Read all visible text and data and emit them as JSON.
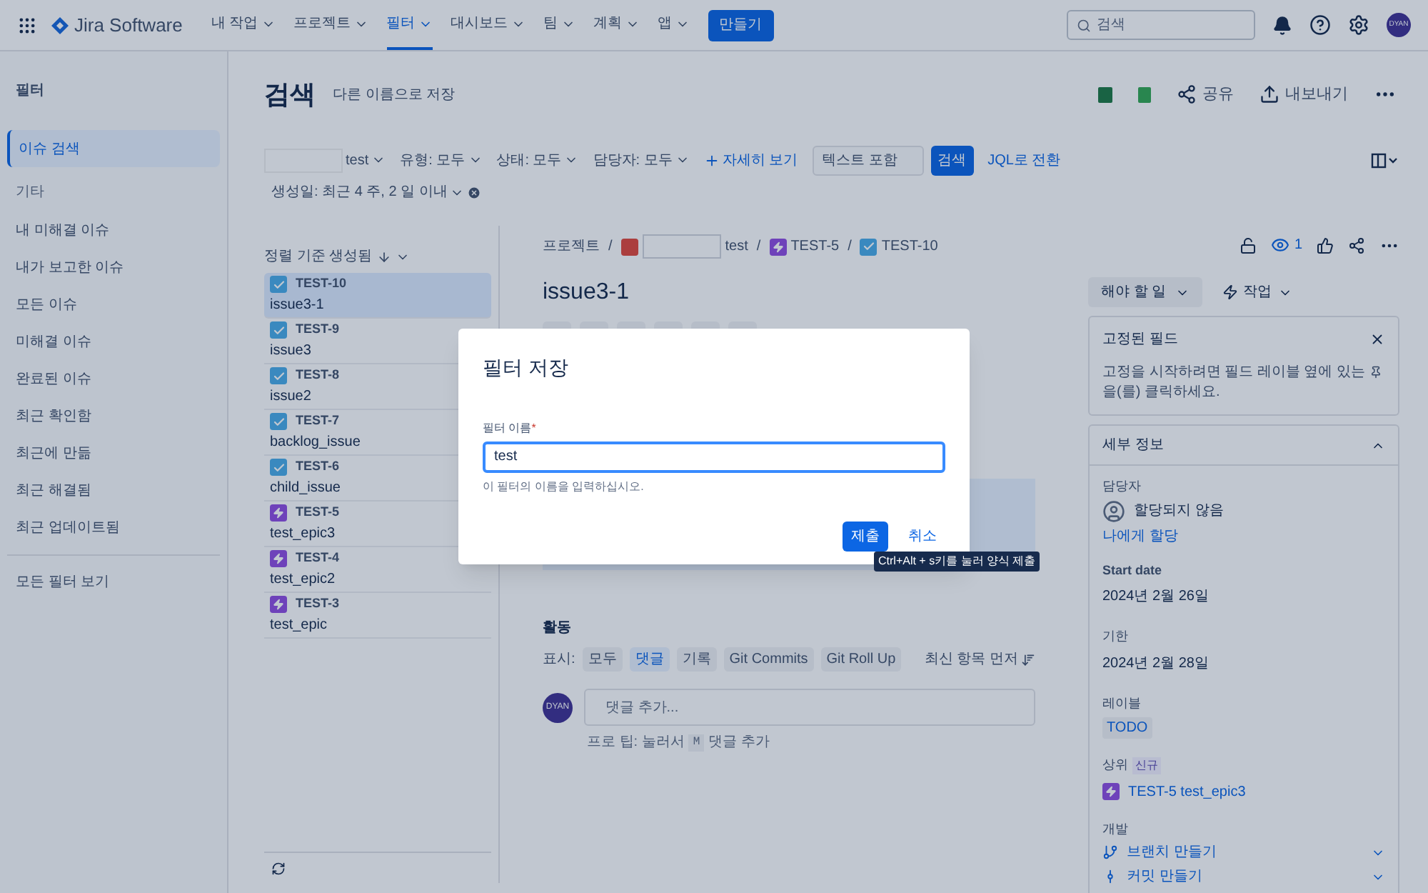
{
  "nav": {
    "app_name": "Jira Software",
    "menus": [
      {
        "label": "내 작업",
        "selected": false
      },
      {
        "label": "프로젝트",
        "selected": false
      },
      {
        "label": "필터",
        "selected": true
      },
      {
        "label": "대시보드",
        "selected": false
      },
      {
        "label": "팀",
        "selected": false
      },
      {
        "label": "계획",
        "selected": false
      },
      {
        "label": "앱",
        "selected": false
      }
    ],
    "create_button": "만들기",
    "search_placeholder": "검색",
    "avatar": "DYAN"
  },
  "sidebar": {
    "title": "필터",
    "items": [
      {
        "label": "이슈 검색",
        "selected": true
      }
    ],
    "section": "기타",
    "section_items": [
      {
        "label": "내 미해결 이슈",
        "selected": false
      },
      {
        "label": "내가 보고한 이슈",
        "selected": false
      },
      {
        "label": "모든 이슈",
        "selected": false
      },
      {
        "label": "미해결 이슈",
        "selected": false
      },
      {
        "label": "완료된 이슈",
        "selected": false
      },
      {
        "label": "최근 확인함",
        "selected": false
      },
      {
        "label": "최근에 만듦",
        "selected": false
      },
      {
        "label": "최근 해결됨",
        "selected": false
      },
      {
        "label": "최근 업데이트됨",
        "selected": false
      }
    ],
    "footer": "모든 필터 보기"
  },
  "header": {
    "title": "검색",
    "save_as": "다른 이름으로 저장",
    "actions": [
      {
        "kind": "excel"
      },
      {
        "kind": "sheets"
      },
      {
        "kind": "share",
        "label": "공유"
      },
      {
        "kind": "export",
        "label": "내보내기"
      },
      {
        "kind": "more"
      }
    ]
  },
  "filters": {
    "project": "test",
    "dropdowns": [
      "유형: 모두",
      "상태: 모두",
      "담당자: 모두"
    ],
    "more": "자세히 보기",
    "text_placeholder": "텍스트 포함",
    "search_button": "검색",
    "jql": "JQL로 전환",
    "created": "생성일: 최근 4 주, 2 일 이내"
  },
  "list": {
    "sort": "정렬 기준 생성됨",
    "issues": [
      {
        "key": "TEST-10",
        "summary": "issue3-1",
        "kind": "task",
        "selected": true
      },
      {
        "key": "TEST-9",
        "summary": "issue3",
        "kind": "task",
        "selected": false
      },
      {
        "key": "TEST-8",
        "summary": "issue2",
        "kind": "task",
        "selected": false
      },
      {
        "key": "TEST-7",
        "summary": "backlog_issue",
        "kind": "task",
        "selected": false
      },
      {
        "key": "TEST-6",
        "summary": "child_issue",
        "kind": "task",
        "selected": false
      },
      {
        "key": "TEST-5",
        "summary": "test_epic3",
        "kind": "epic",
        "selected": false
      },
      {
        "key": "TEST-4",
        "summary": "test_epic2",
        "kind": "epic",
        "selected": false
      },
      {
        "key": "TEST-3",
        "summary": "test_epic",
        "kind": "epic",
        "selected": false
      }
    ]
  },
  "detail": {
    "breadcrumb": [
      {
        "label": "프로젝트"
      },
      {
        "separator": "/",
        "label": "test",
        "kind": "project"
      },
      {
        "separator": "/",
        "label": "TEST-5",
        "kind": "epic"
      },
      {
        "separator": "/",
        "label": "TEST-10",
        "kind": "task"
      }
    ],
    "title": "issue3-1",
    "watchers": "1",
    "activity": {
      "title": "활동",
      "show_label": "표시:",
      "tabs": [
        {
          "label": "모두",
          "selected": false
        },
        {
          "label": "댓글",
          "selected": true
        },
        {
          "label": "기록",
          "selected": false
        },
        {
          "label": "Git Commits",
          "selected": false
        },
        {
          "label": "Git Roll Up",
          "selected": false
        }
      ],
      "sort": "최신 항목 먼저",
      "avatar": "DYAN",
      "comment_placeholder": "댓글 추가...",
      "tip_before": "프로 팁: 눌러서",
      "tip_key": "M",
      "tip_after": "댓글 추가"
    }
  },
  "side": {
    "status": "해야 할 일",
    "action": "작업",
    "pinned": {
      "title": "고정된 필드",
      "text_before": "고정을 시작하려면 필드 레이블 옆에 있는",
      "text_after": "을(를) 클릭하세요."
    },
    "details": {
      "title": "세부 정보",
      "assignee_label": "담당자",
      "assignee": "할당되지 않음",
      "assign_me": "나에게 할당",
      "start_label": "Start date",
      "start": "2024년 2월 26일",
      "due_label": "기한",
      "due": "2024년 2월 28일",
      "labels_label": "레이블",
      "labels": [
        "TODO"
      ],
      "parent_label": "상위",
      "parent_badge": "신규",
      "parent": "TEST-5 test_epic3",
      "dev_label": "개발",
      "dev_items": [
        "브랜치 만들기",
        "커밋 만들기"
      ]
    }
  },
  "modal": {
    "title": "필터 저장",
    "field_label": "필터 이름",
    "required_mark": "*",
    "value": "test",
    "help": "이 필터의 이름을 입력하십시오.",
    "submit": "제출",
    "cancel": "취소",
    "tooltip": "Ctrl+Alt + s키를 눌러 양식 제출"
  }
}
